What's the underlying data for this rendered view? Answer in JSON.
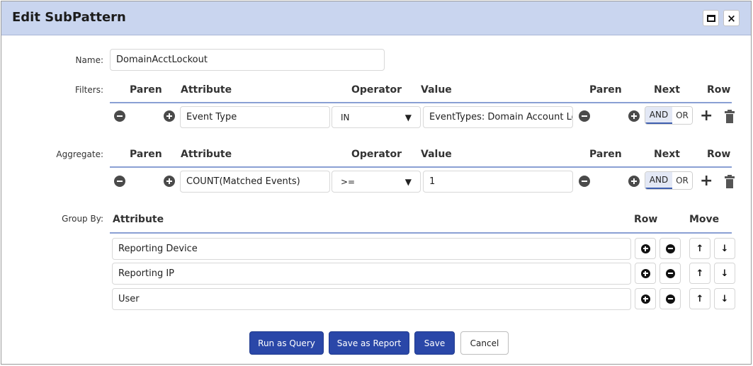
{
  "window": {
    "title": "Edit SubPattern"
  },
  "name_field": {
    "label": "Name:",
    "value": "DomainAcctLockout"
  },
  "filters": {
    "label": "Filters:",
    "headers": {
      "paren_left": "Paren",
      "attribute": "Attribute",
      "operator": "Operator",
      "value": "Value",
      "paren_right": "Paren",
      "next": "Next",
      "row": "Row"
    },
    "row": {
      "attribute": "Event Type",
      "operator": "IN",
      "value": "EventTypes: Domain Account Loc",
      "and": "AND",
      "or": "OR"
    }
  },
  "aggregate": {
    "label": "Aggregate:",
    "headers": {
      "paren_left": "Paren",
      "attribute": "Attribute",
      "operator": "Operator",
      "value": "Value",
      "paren_right": "Paren",
      "next": "Next",
      "row": "Row"
    },
    "row": {
      "attribute": "COUNT(Matched Events)",
      "operator": ">=",
      "value": "1",
      "and": "AND",
      "or": "OR"
    }
  },
  "group_by": {
    "label": "Group By:",
    "headers": {
      "attribute": "Attribute",
      "row": "Row",
      "move": "Move"
    },
    "rows": [
      {
        "attribute": "Reporting Device"
      },
      {
        "attribute": "Reporting IP"
      },
      {
        "attribute": "User"
      }
    ]
  },
  "buttons": {
    "run_query": "Run as Query",
    "save_report": "Save as Report",
    "save": "Save",
    "cancel": "Cancel"
  },
  "icons": {
    "close": "×",
    "arrow_up": "↑",
    "arrow_down": "↓",
    "chevron": "⌄"
  },
  "colors": {
    "titlebar": "#c9d5ef",
    "primary": "#2a47a8",
    "header_line": "#8aa0d4"
  }
}
